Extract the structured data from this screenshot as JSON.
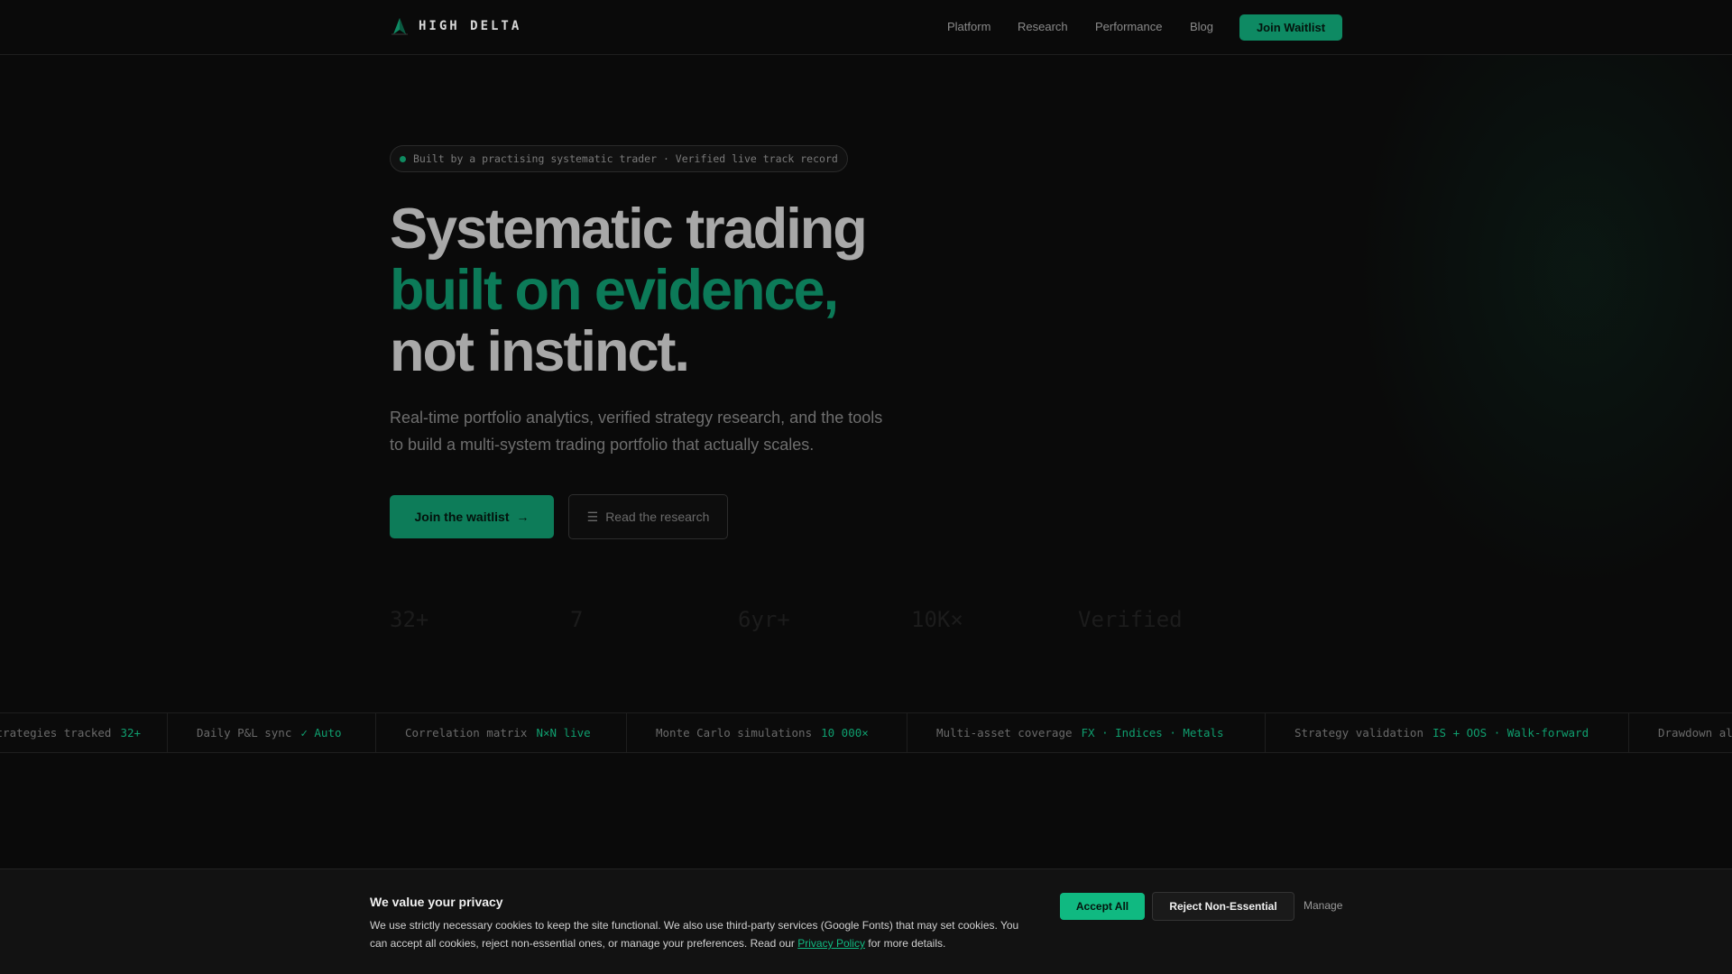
{
  "brand": {
    "name": "HIGH DELTA",
    "logo_icon": "delta-logo-icon",
    "accent": "#10b981"
  },
  "nav": {
    "links": [
      "Platform",
      "Research",
      "Performance",
      "Blog"
    ],
    "cta": "Join Waitlist"
  },
  "hero": {
    "badge": "Built by a practising systematic trader · Verified live track record",
    "headline_line1": "Systematic trading",
    "headline_line2": "built on evidence,",
    "headline_line3": "not instinct.",
    "subtext": "Real-time portfolio analytics, verified strategy research, and the tools to build a multi-system trading portfolio that actually scales.",
    "primary_button": "Join the waitlist",
    "primary_button_icon": "arrow-right-icon",
    "secondary_button": "Read the research",
    "secondary_button_icon": "menu-lines-icon"
  },
  "stats": [
    "32+",
    "7",
    "6yr+",
    "10K×",
    "Verified"
  ],
  "ticker": [
    {
      "label": "Strategies tracked",
      "value": "32+"
    },
    {
      "label": "Daily P&L sync",
      "value": "✓ Auto"
    },
    {
      "label": "Correlation matrix",
      "value": "N×N live"
    },
    {
      "label": "Monte Carlo simulations",
      "value": "10 000×"
    },
    {
      "label": "Multi-asset coverage",
      "value": "FX · Indices · Metals"
    },
    {
      "label": "Strategy validation",
      "value": "IS + OOS · Walk-forward"
    },
    {
      "label": "Drawdown al",
      "value": ""
    }
  ],
  "cookie": {
    "title": "We value your privacy",
    "text_before": "We use strictly necessary cookies to keep the site functional. We also use third-party services (Google Fonts) that may set cookies. You can accept all cookies, reject non-essential ones, or manage your preferences. Read our ",
    "link": "Privacy Policy",
    "text_after": " for more details.",
    "accept": "Accept All",
    "reject": "Reject Non-Essential",
    "manage": "Manage"
  }
}
